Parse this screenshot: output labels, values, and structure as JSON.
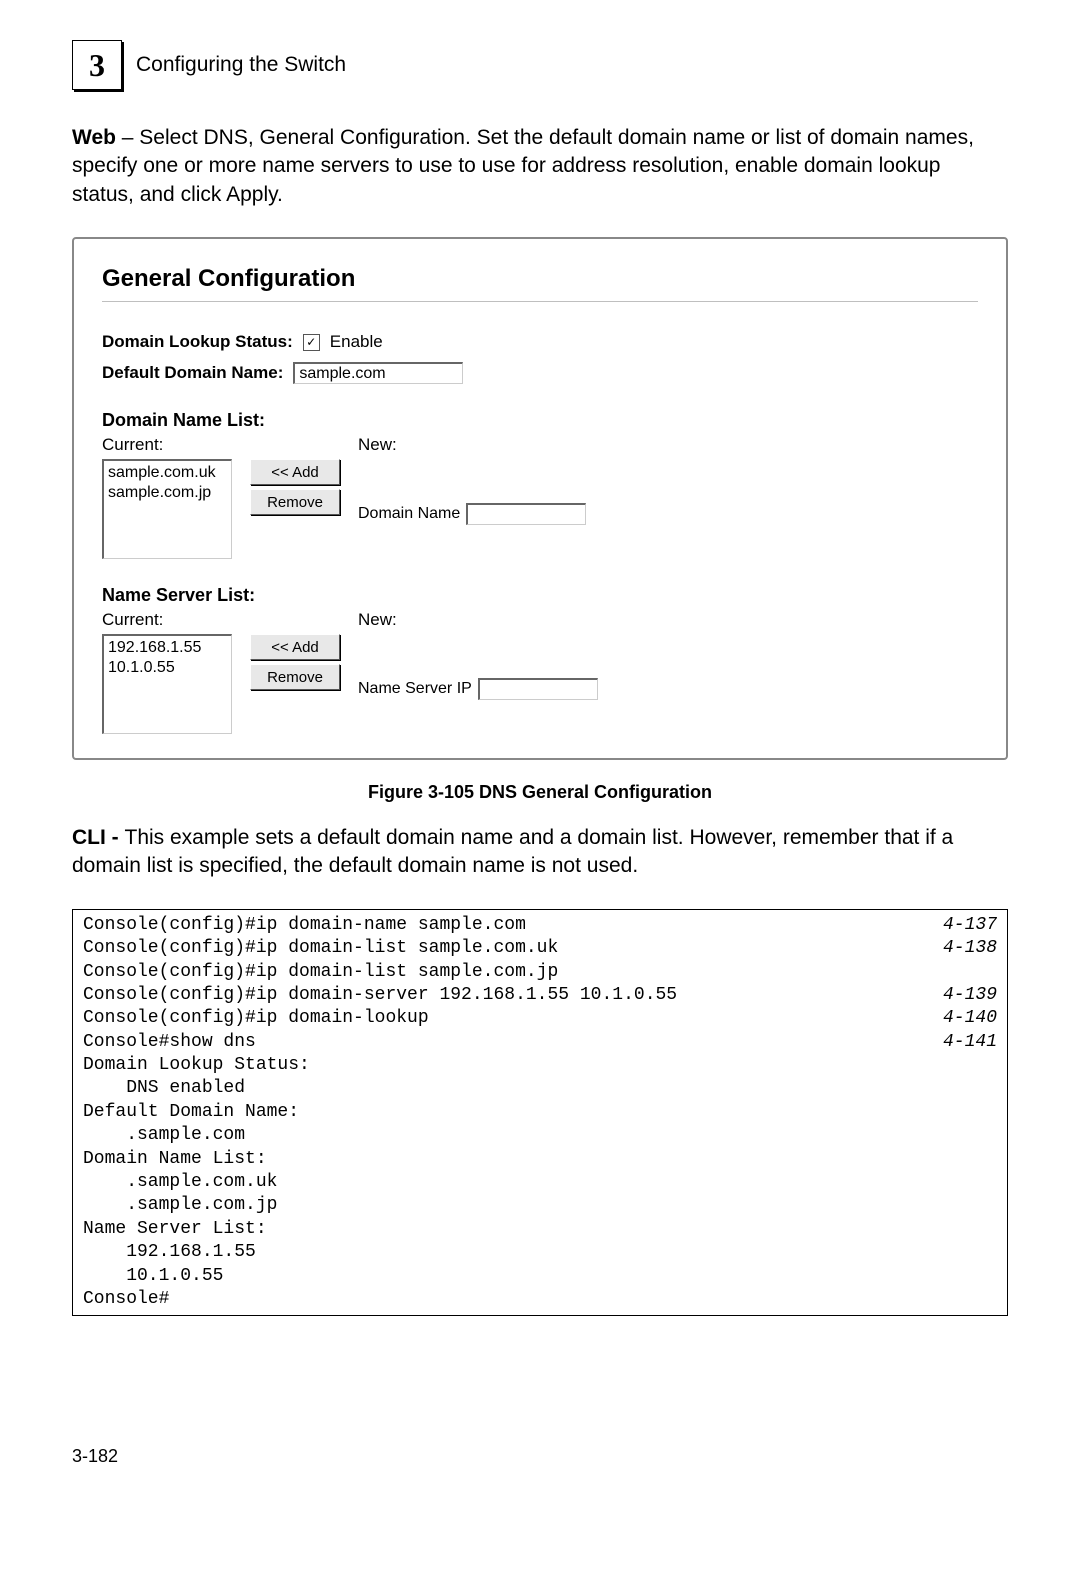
{
  "header": {
    "chapter_number": "3",
    "chapter_title": "Configuring the Switch"
  },
  "intro": {
    "label_web": "Web",
    "text": " – Select DNS, General Configuration. Set the default domain name or list of domain names, specify one or more name servers to use to use for address resolution, enable domain lookup status, and click Apply."
  },
  "panel": {
    "title": "General Configuration",
    "domain_lookup_label": "Domain Lookup Status:",
    "enable_label": "Enable",
    "enable_checked": "✓",
    "default_domain_label": "Default Domain Name:",
    "default_domain_value": "sample.com",
    "domain_name_list": {
      "heading": "Domain Name List:",
      "current_label": "Current:",
      "new_label": "New:",
      "items": [
        "sample.com.uk",
        "sample.com.jp"
      ],
      "add_label": "<< Add",
      "remove_label": "Remove",
      "input_label": "Domain Name",
      "input_value": ""
    },
    "name_server_list": {
      "heading": "Name Server List:",
      "current_label": "Current:",
      "new_label": "New:",
      "items": [
        "192.168.1.55",
        "10.1.0.55"
      ],
      "add_label": "<< Add",
      "remove_label": "Remove",
      "input_label": "Name Server IP",
      "input_value": ""
    }
  },
  "figure_caption": "Figure 3-105   DNS General Configuration",
  "cli_intro": {
    "label": "CLI - ",
    "text": "This example sets a default domain name and a domain list. However, remember that if a domain list is specified, the default domain name is not used."
  },
  "cli": {
    "lines": [
      {
        "text": "Console(config)#ip domain-name sample.com",
        "ref": "4-137"
      },
      {
        "text": "Console(config)#ip domain-list sample.com.uk",
        "ref": "4-138"
      },
      {
        "text": "Console(config)#ip domain-list sample.com.jp",
        "ref": ""
      },
      {
        "text": "Console(config)#ip domain-server 192.168.1.55 10.1.0.55",
        "ref": "4-139"
      },
      {
        "text": "Console(config)#ip domain-lookup",
        "ref": "4-140"
      },
      {
        "text": "Console#show dns",
        "ref": "4-141"
      },
      {
        "text": "Domain Lookup Status:",
        "ref": ""
      },
      {
        "text": "    DNS enabled",
        "ref": ""
      },
      {
        "text": "Default Domain Name:",
        "ref": ""
      },
      {
        "text": "    .sample.com",
        "ref": ""
      },
      {
        "text": "Domain Name List:",
        "ref": ""
      },
      {
        "text": "    .sample.com.uk",
        "ref": ""
      },
      {
        "text": "    .sample.com.jp",
        "ref": ""
      },
      {
        "text": "Name Server List:",
        "ref": ""
      },
      {
        "text": "    192.168.1.55",
        "ref": ""
      },
      {
        "text": "    10.1.0.55",
        "ref": ""
      },
      {
        "text": "Console#",
        "ref": ""
      }
    ]
  },
  "page_number": "3-182"
}
